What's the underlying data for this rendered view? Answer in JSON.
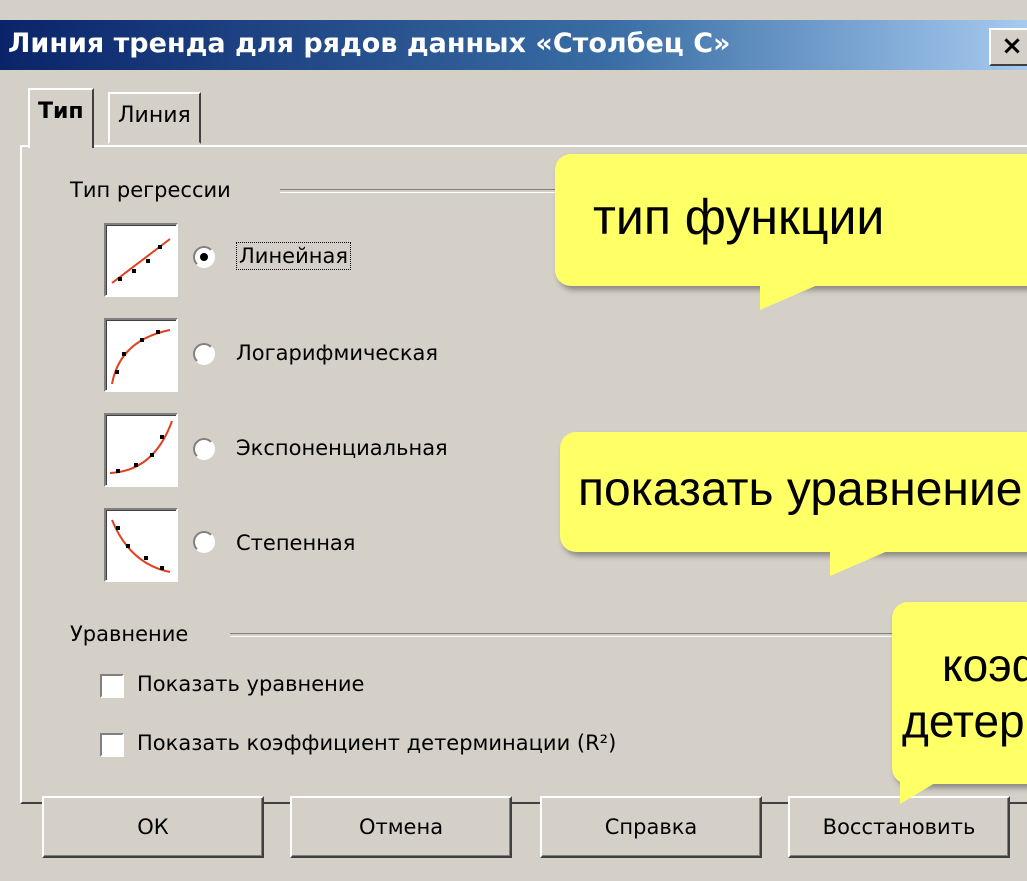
{
  "window": {
    "title": "Линия тренда для рядов данных «Столбец С»",
    "close_symbol": "×"
  },
  "tabs": [
    {
      "label": "Тип",
      "active": true
    },
    {
      "label": "Линия",
      "active": false
    }
  ],
  "regression": {
    "group_label": "Тип регрессии",
    "options": [
      {
        "label": "Линейная",
        "checked": true,
        "icon": "linear-trend-icon"
      },
      {
        "label": "Логарифмическая",
        "checked": false,
        "icon": "logarithmic-trend-icon"
      },
      {
        "label": "Экспоненциальная",
        "checked": false,
        "icon": "exponential-trend-icon"
      },
      {
        "label": "Степенная",
        "checked": false,
        "icon": "power-trend-icon"
      }
    ]
  },
  "equation": {
    "group_label": "Уравнение",
    "show_equation": {
      "label": "Показать уравнение",
      "checked": false
    },
    "show_r2": {
      "label": "Показать коэффициент детерминации (R²)",
      "checked": false
    }
  },
  "buttons": {
    "ok": "ОК",
    "cancel": "Отмена",
    "help": "Справка",
    "reset": "Восстановить"
  },
  "callouts": {
    "function_type": "тип функции",
    "show_equation": "показать уравнение",
    "coefficient": [
      "коэффициент",
      "детерминации"
    ]
  },
  "colors": {
    "dialog_bg": "#d4d0c8",
    "title_start": "#0a246a",
    "title_end": "#a6caf0",
    "callout_bg": "#ffff66",
    "trend_line": "#e04020"
  }
}
